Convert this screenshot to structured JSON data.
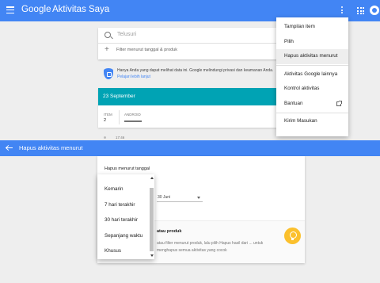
{
  "appbar": {
    "logo": "Google",
    "title": "Aktivitas Saya"
  },
  "search": {
    "placeholder": "Telusuri",
    "filter_label": "Filter menurut tanggal & produk"
  },
  "privacy": {
    "text": "Hanya Anda yang dapat melihat data ini. Google melindungi privasi dan keamanan Anda.",
    "link": "Pelajari lebih lanjut"
  },
  "date_card": {
    "date": "23 September",
    "item_label": "ITEM",
    "item_count": "2",
    "product_label": "ANDROID"
  },
  "timeline": {
    "time": "17:46"
  },
  "overflow_menu": {
    "items": [
      "Tampilan item",
      "Pilih",
      "Hapus aktivitas menurut",
      "Aktivitas Google lainnya",
      "Kontrol aktivitas",
      "Bantuan",
      "Kirim Masukan"
    ]
  },
  "delete_sheet": {
    "title": "Hapus aktivitas menurut",
    "date_label": "Hapus menurut tanggal",
    "date_value": "30 Juni",
    "product_title": "atau produk",
    "product_desc": "atau filter menurut produk, lalu pilih Hapus hasil dari ... untuk menghapus semua aktivitas yang cocok",
    "dropdown_options": [
      "Kemarin",
      "7 hari terakhir",
      "30 hari terakhir",
      "Sepanjang waktu",
      "Khusus"
    ]
  },
  "colors": {
    "accent": "#4285f4",
    "date_header": "#00a3b4",
    "tip_bulb": "#fbc02d"
  }
}
